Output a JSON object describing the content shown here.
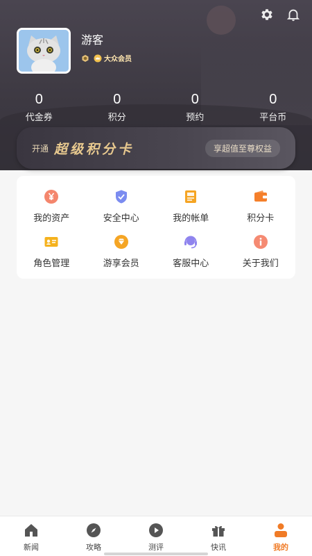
{
  "header": {
    "settings_icon": "gear-icon",
    "notification_icon": "bell-icon"
  },
  "profile": {
    "username": "游客",
    "level_icon": "level-badge-icon",
    "member_label": "大众会员"
  },
  "stats": [
    {
      "value": "0",
      "label": "代金券"
    },
    {
      "value": "0",
      "label": "积分"
    },
    {
      "value": "0",
      "label": "预约"
    },
    {
      "value": "0",
      "label": "平台币"
    }
  ],
  "vip_card": {
    "prefix": "开通",
    "title": "超级积分卡",
    "action": "享超值至尊权益"
  },
  "menu": [
    {
      "label": "我的资产",
      "icon": "yuan-coin-icon",
      "color": "#f4866d"
    },
    {
      "label": "安全中心",
      "icon": "shield-check-icon",
      "color": "#7b8cf0"
    },
    {
      "label": "我的帐单",
      "icon": "bill-icon",
      "color": "#f5a524"
    },
    {
      "label": "积分卡",
      "icon": "wallet-icon",
      "color": "#f57f2b"
    },
    {
      "label": "角色管理",
      "icon": "id-card-icon",
      "color": "#f5b21e"
    },
    {
      "label": "游享会员",
      "icon": "vip-diamond-icon",
      "color": "#f5a524"
    },
    {
      "label": "客服中心",
      "icon": "headset-icon",
      "color": "#8f84ee"
    },
    {
      "label": "关于我们",
      "icon": "info-icon",
      "color": "#f58a72"
    }
  ],
  "tabs": [
    {
      "label": "新闻",
      "icon": "home-icon",
      "active": false
    },
    {
      "label": "攻略",
      "icon": "compass-icon",
      "active": false
    },
    {
      "label": "测评",
      "icon": "play-icon",
      "active": false
    },
    {
      "label": "快讯",
      "icon": "gift-icon",
      "active": false
    },
    {
      "label": "我的",
      "icon": "person-icon",
      "active": true
    }
  ],
  "colors": {
    "accent": "#f07b26",
    "header_bg": "#3d3942",
    "vip_gold": "#e8c98f"
  }
}
